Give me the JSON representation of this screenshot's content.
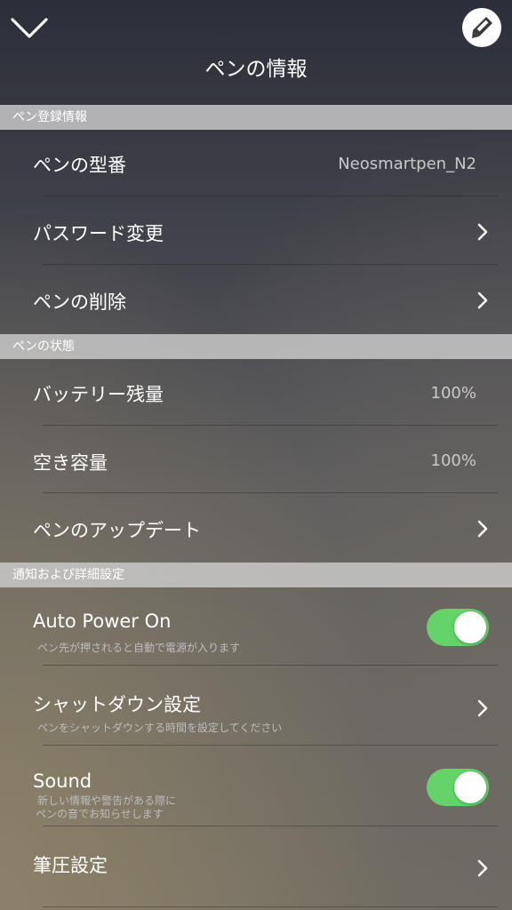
{
  "header": {
    "title": "ペンの情報"
  },
  "sections": {
    "registration": {
      "title": "ペン登録情報",
      "model_label": "ペンの型番",
      "model_value": "Neosmartpen_N2",
      "password_label": "パスワード変更",
      "delete_label": "ペンの削除"
    },
    "status": {
      "title": "ペンの状態",
      "battery_label": "バッテリー残量",
      "battery_value": "100%",
      "storage_label": "空き容量",
      "storage_value": "100%",
      "update_label": "ペンのアップデート"
    },
    "settings": {
      "title": "通知および詳細設定",
      "auto_power_label": "Auto Power On",
      "auto_power_sub": "ペン先が押されると自動で電源が入ります",
      "auto_power_on": true,
      "shutdown_label": "シャットダウン設定",
      "shutdown_sub": "ペンをシャットダウンする時間を設定してください",
      "sound_label": "Sound",
      "sound_sub_line1": "新しい情報や警告がある際に",
      "sound_sub_line2": "ペンの音でお知らせします",
      "sound_on": true,
      "pressure_label": "筆圧設定"
    }
  },
  "colors": {
    "toggle_on": "#64d36a",
    "section_header": "#cdcdcd"
  }
}
